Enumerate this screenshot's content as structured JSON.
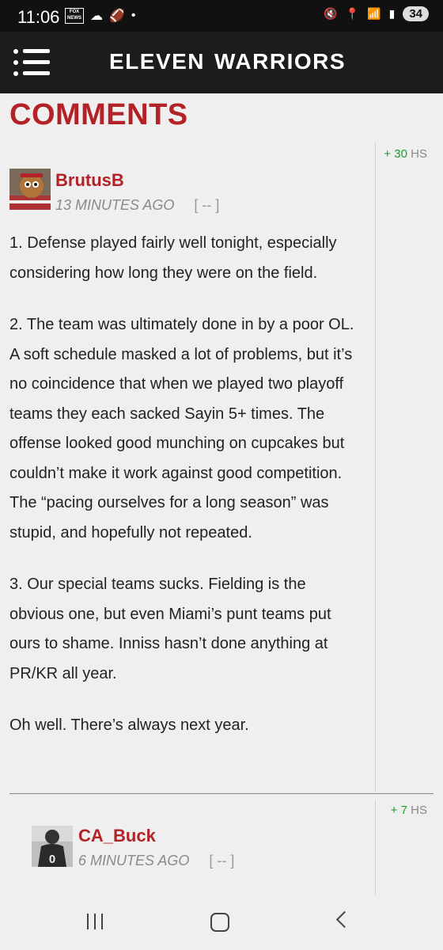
{
  "status_bar": {
    "time": "11:06",
    "fox_badge": "FOX NEWS",
    "battery": "34",
    "network": "6"
  },
  "header": {
    "logo_left": "ELEVEN",
    "logo_right": "WARRIORS"
  },
  "page": {
    "title": "COMMENTS"
  },
  "comments": [
    {
      "score": "+ 30",
      "score_unit": "HS",
      "username": "BrutusB",
      "time": "13 MINUTES AGO",
      "collapse": "[ -- ]",
      "paragraphs": [
        "1. Defense played fairly well tonight, especially considering how long they were on the field.",
        "2. The team was ultimately done in by a poor OL.  A soft schedule masked a lot of problems, but it’s no coincidence that when we played two playoff teams they each sacked Sayin 5+ times. The offense looked good munching on cupcakes but couldn’t make it work against good competition.  The “pacing ourselves for a long season” was stupid, and hopefully not repeated.",
        "3. Our special teams sucks.  Fielding is the obvious one, but even Miami’s punt teams put ours to shame.  Inniss hasn’t done anything at PR/KR all year.",
        "Oh well.  There’s always next year."
      ]
    },
    {
      "score": "+ 7",
      "score_unit": "HS",
      "username": "CA_Buck",
      "time": "6 MINUTES AGO",
      "collapse": "[ -- ]",
      "jersey_number": "0"
    }
  ],
  "colors": {
    "accent": "#b22227",
    "score_green": "#1f9a2e",
    "header_bg": "#1c1c1c"
  }
}
